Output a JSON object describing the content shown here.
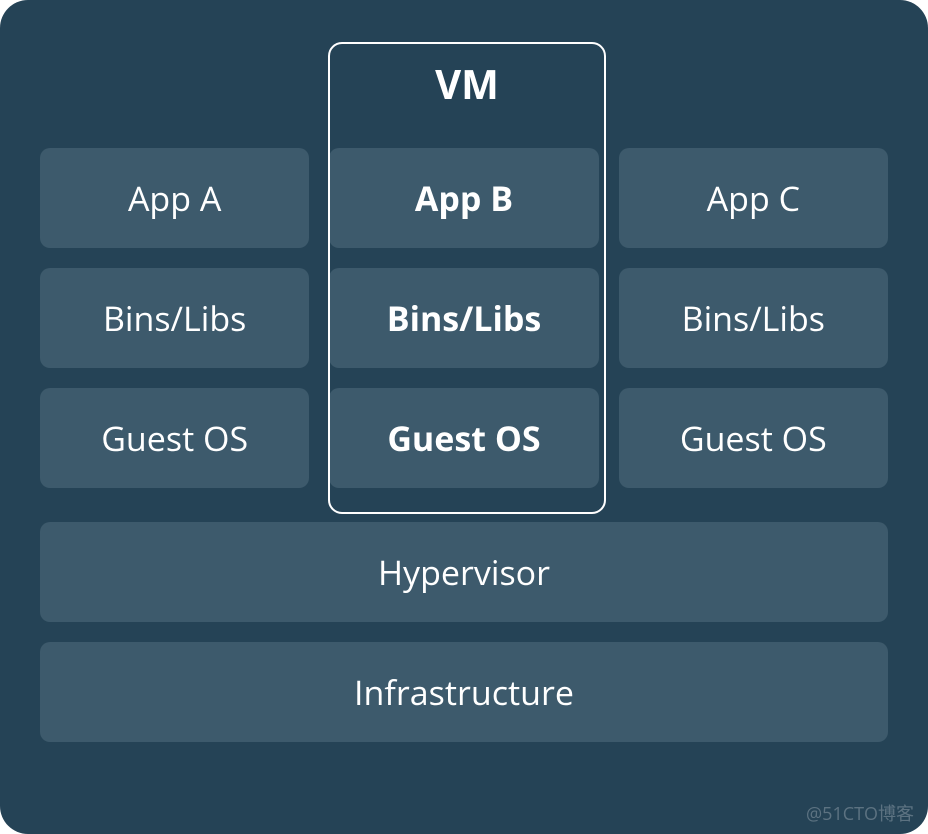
{
  "diagram": {
    "vm_label": "VM",
    "columns": [
      {
        "app": "App A",
        "bins": "Bins/Libs",
        "os": "Guest OS"
      },
      {
        "app": "App B",
        "bins": "Bins/Libs",
        "os": "Guest OS"
      },
      {
        "app": "App C",
        "bins": "Bins/Libs",
        "os": "Guest OS"
      }
    ],
    "hypervisor": "Hypervisor",
    "infrastructure": "Infrastructure"
  },
  "watermark": "@51CTO博客"
}
